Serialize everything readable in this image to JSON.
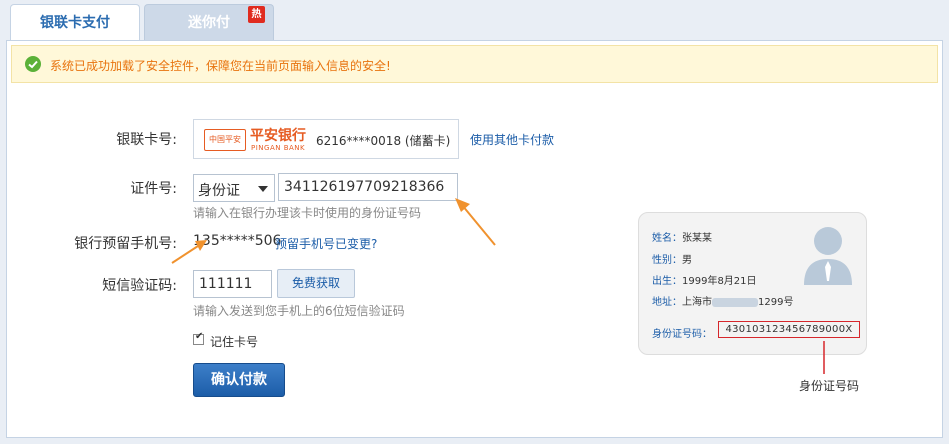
{
  "tabs": [
    {
      "label": "银联卡支付",
      "active": true
    },
    {
      "label": "迷你付",
      "active": false,
      "badge": "热"
    }
  ],
  "notice": {
    "text": "系统已成功加载了安全控件，保障您在当前页面输入信息的安全!"
  },
  "form": {
    "card_label": "银联卡号:",
    "bank_logo_cn": "中国平安",
    "bank_name": "平安银行",
    "bank_name_en": "PINGAN BANK",
    "card_number": "6216****0018 (储蓄卡)",
    "other_card_link": "使用其他卡付款",
    "id_label": "证件号:",
    "id_type": "身份证",
    "id_number": "341126197709218366",
    "id_hint": "请输入在银行办理该卡时使用的身份证号码",
    "phone_label": "银行预留手机号:",
    "phone_value": "135*****506",
    "phone_changed_link": "预留手机号已变更?",
    "sms_label": "短信验证码:",
    "sms_value": "111111",
    "sms_button": "免费获取",
    "sms_hint": "请输入发送到您手机上的6位短信验证码",
    "remember_label": "记住卡号",
    "remember_checked": true,
    "pay_button": "确认付款"
  },
  "id_card": {
    "name_key": "姓名：",
    "name_val": "张某某",
    "gender_key": "性别：",
    "gender_val": "男",
    "birth_key": "出生：",
    "birth_val": "1999年8月21日",
    "addr_key": "地址：",
    "addr_prefix": "上海市",
    "addr_suffix": "1299号",
    "idno_key": "身份证号码：",
    "idno_val": "430103123456789000X",
    "caption": "身份证号码"
  },
  "colors": {
    "accent": "#1c5da8",
    "arrow": "#f0922e",
    "notice_text": "#e8730e",
    "highlight": "#d6262b"
  }
}
